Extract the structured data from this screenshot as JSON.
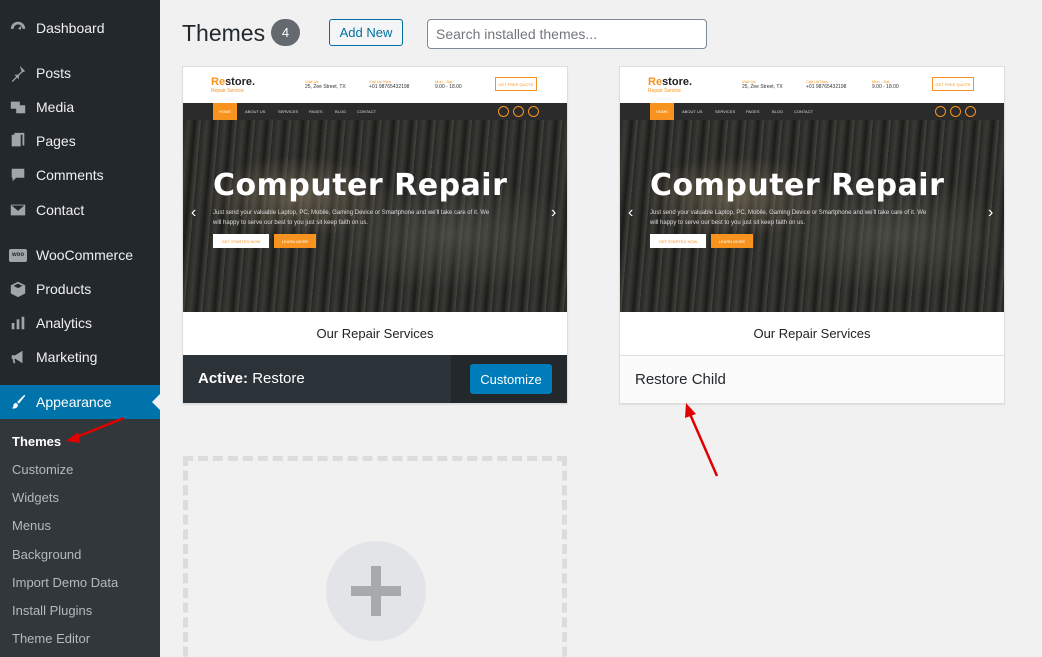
{
  "sidebar": {
    "items": [
      {
        "label": "Dashboard",
        "icon": "dashboard-icon"
      },
      {
        "label": "Posts",
        "icon": "pin-icon"
      },
      {
        "label": "Media",
        "icon": "media-icon"
      },
      {
        "label": "Pages",
        "icon": "pages-icon"
      },
      {
        "label": "Comments",
        "icon": "comments-icon"
      },
      {
        "label": "Contact",
        "icon": "envelope-icon"
      },
      {
        "label": "WooCommerce",
        "icon": "woo-icon"
      },
      {
        "label": "Products",
        "icon": "box-icon"
      },
      {
        "label": "Analytics",
        "icon": "bar-chart-icon"
      },
      {
        "label": "Marketing",
        "icon": "megaphone-icon"
      },
      {
        "label": "Appearance",
        "icon": "brush-icon"
      }
    ],
    "woo_badge": "woo",
    "submenu": [
      "Themes",
      "Customize",
      "Widgets",
      "Menus",
      "Background",
      "Import Demo Data",
      "Install Plugins",
      "Theme Editor"
    ]
  },
  "header": {
    "title": "Themes",
    "count": "4",
    "add_new": "Add New",
    "search_placeholder": "Search installed themes..."
  },
  "themes": [
    {
      "preview": {
        "logo_re": "Re",
        "logo_rest": "store.",
        "logo_sub": "Repair Service",
        "info1_top": "Visit Us",
        "info1": "25, Zee Street, TX",
        "info2_top": "Call Us Now",
        "info2": "+01 98765432198",
        "info3_top": "Mon - Sat",
        "info3": "9.00 - 18.00",
        "quote": "GET FREE QUOTE",
        "nav": [
          "HOME",
          "ABOUT US",
          "SERVICES",
          "PAGES",
          "BLOG",
          "CONTACT"
        ],
        "hero_title": "Computer Repair",
        "hero_text": "Just send your valuable Laptop, PC, Mobile, Gaming Device or Smartphone and we'll take care of it. We will happy to serve our best to you just sit keep faith on us.",
        "btn1": "GET STARTED NOW",
        "btn2": "LEARN MORE",
        "services": "Our Repair Services"
      },
      "active_prefix": "Active:",
      "name": "Restore",
      "customize": "Customize"
    },
    {
      "preview": {
        "logo_re": "Re",
        "logo_rest": "store.",
        "logo_sub": "Repair Service",
        "info1_top": "Visit Us",
        "info1": "25, Zee Street, TX",
        "info2_top": "Call Us Now",
        "info2": "+01 98765432198",
        "info3_top": "Mon - Sat",
        "info3": "9.00 - 18.00",
        "quote": "GET FREE QUOTE",
        "nav": [
          "HOME",
          "ABOUT US",
          "SERVICES",
          "PAGES",
          "BLOG",
          "CONTACT"
        ],
        "hero_title": "Computer Repair",
        "hero_text": "Just send your valuable Laptop, PC, Mobile, Gaming Device or Smartphone and we'll take care of it. We will happy to serve our best to you just sit keep faith on us.",
        "btn1": "GET STARTED NOW",
        "btn2": "LEARN MORE",
        "services": "Our Repair Services"
      },
      "name": "Restore Child"
    }
  ],
  "colors": {
    "sidebar": "#23282d",
    "accent": "#0073aa",
    "brand_orange": "#f7931e",
    "annotation_red": "#e00000"
  }
}
